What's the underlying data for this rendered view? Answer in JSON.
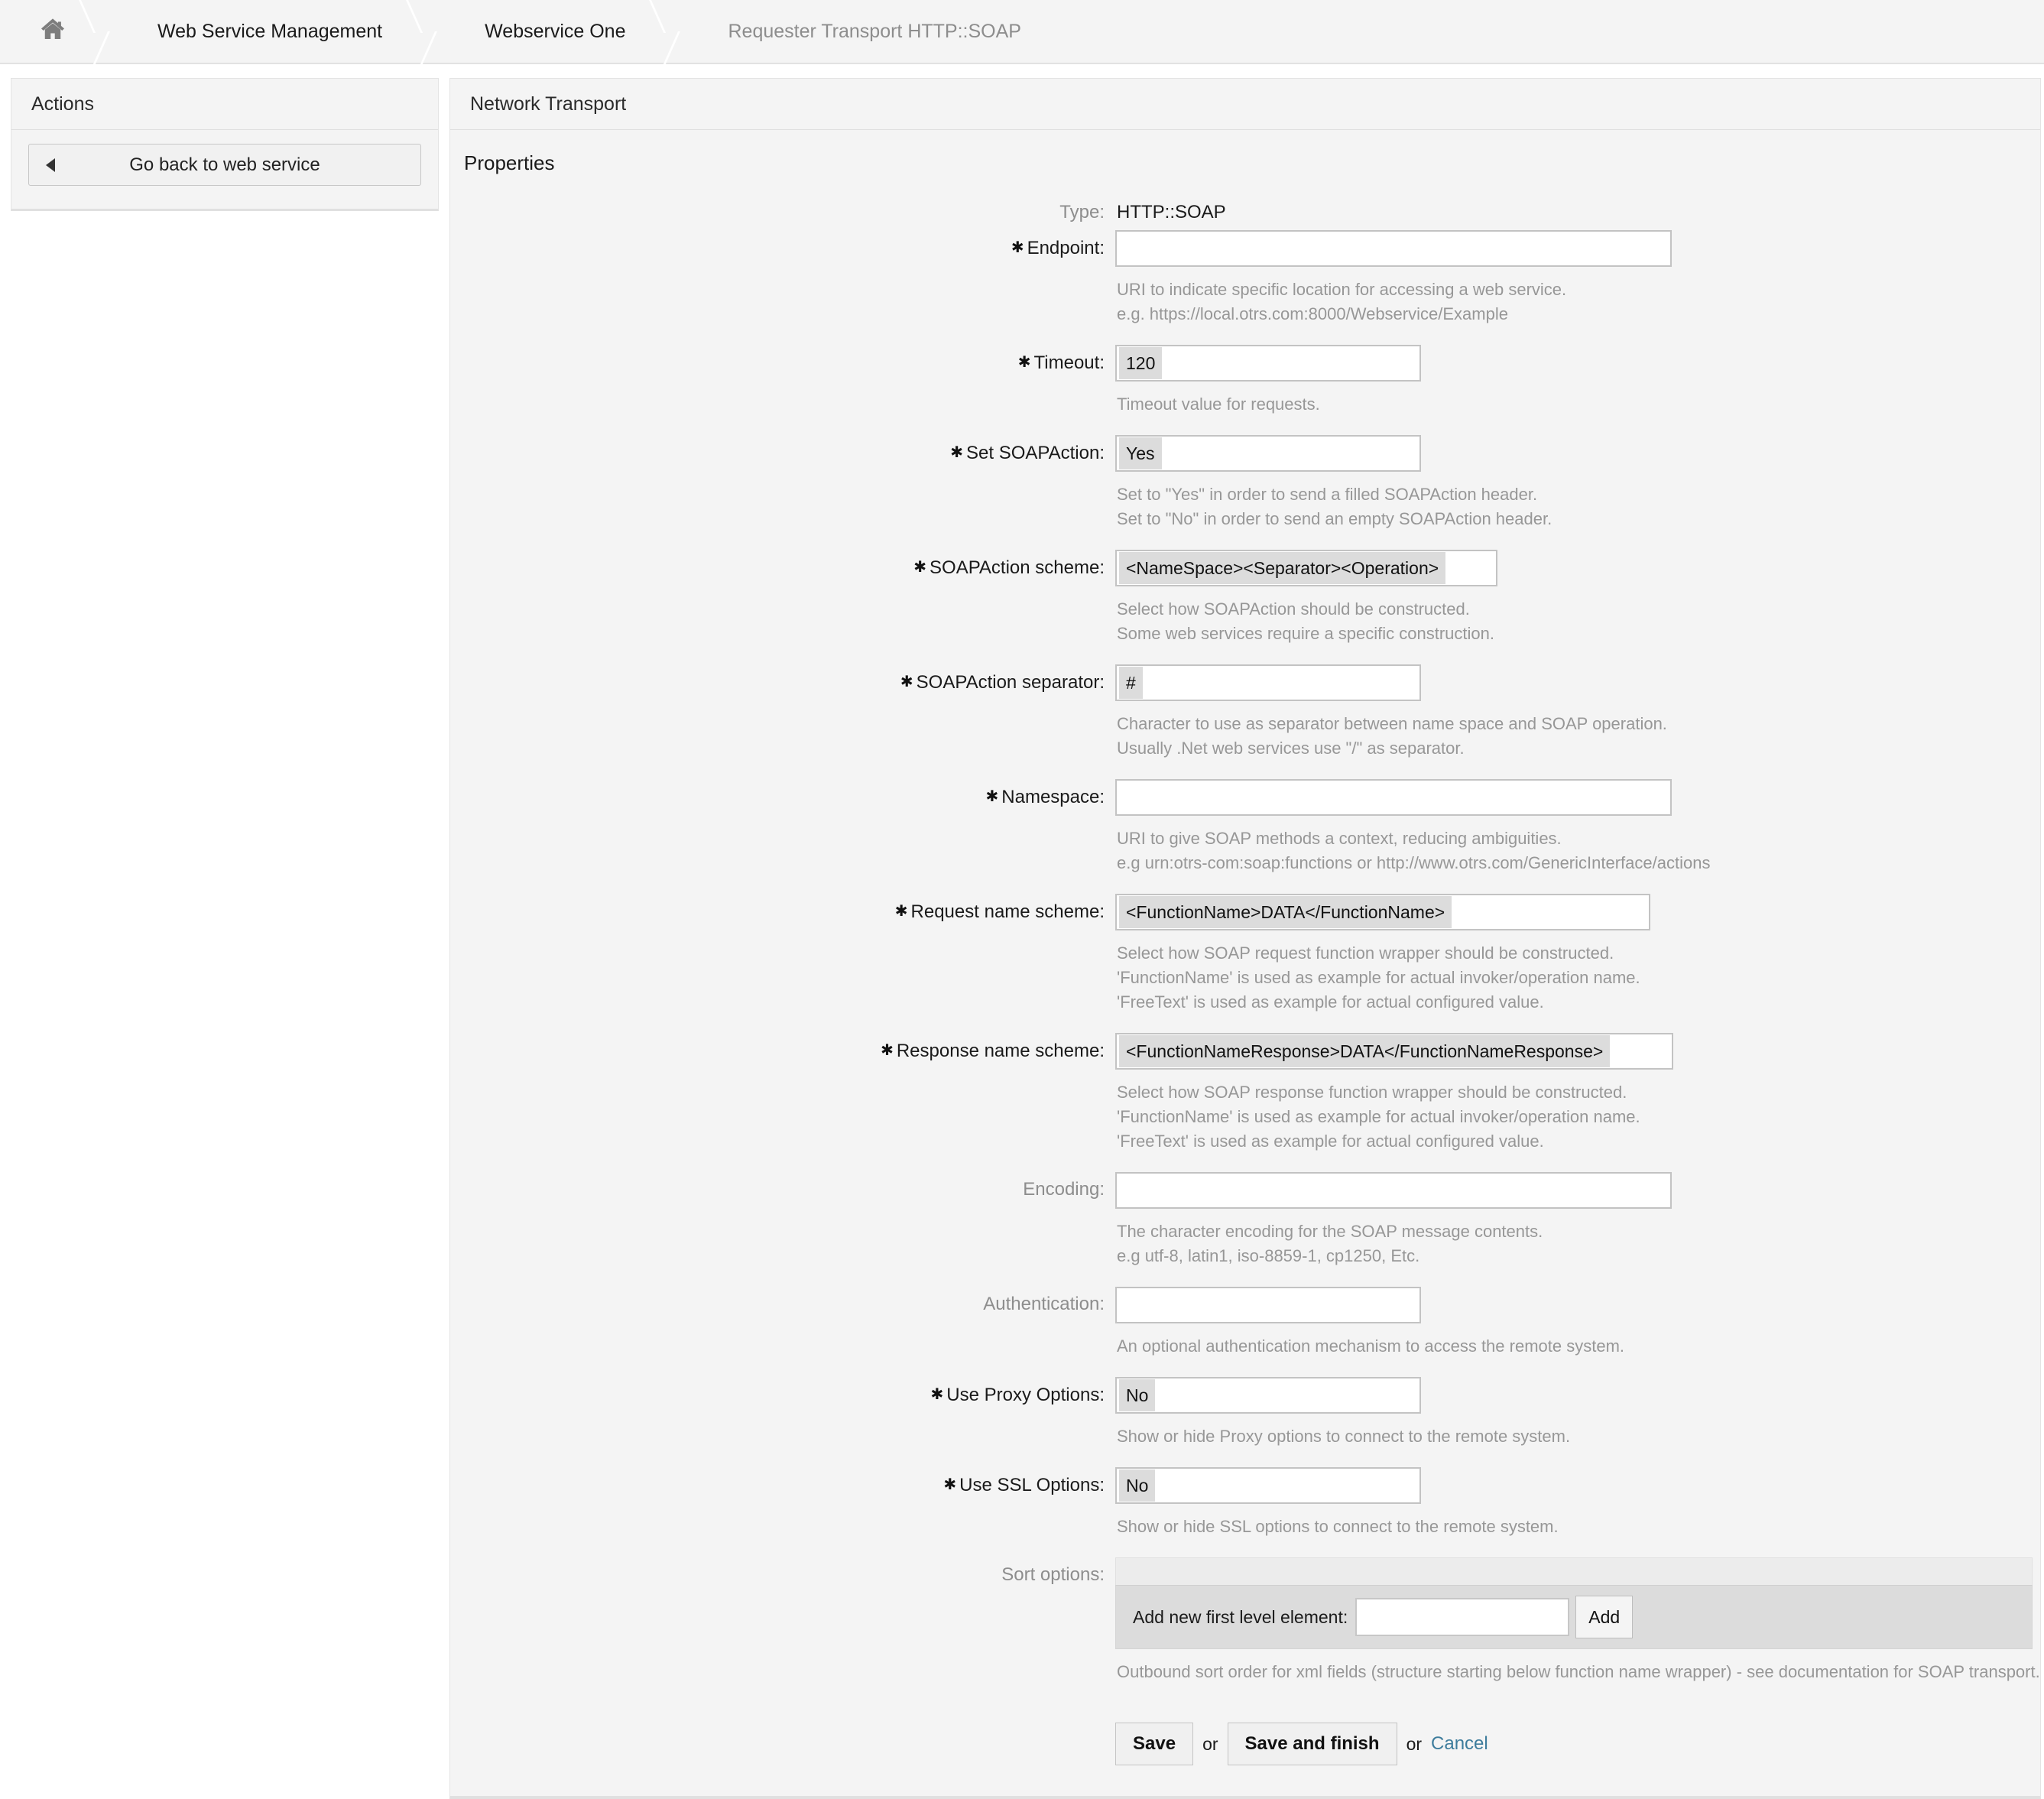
{
  "breadcrumb": {
    "home_icon": "home-icon",
    "items": [
      {
        "label": "Web Service Management",
        "current": false
      },
      {
        "label": "Webservice One",
        "current": false
      },
      {
        "label": "Requester Transport HTTP::SOAP",
        "current": true
      }
    ]
  },
  "sidebar": {
    "title": "Actions",
    "back_button": "Go back to web service"
  },
  "main": {
    "header": "Network Transport",
    "section_title": "Properties"
  },
  "fields": {
    "type": {
      "label": "Type:",
      "value": "HTTP::SOAP"
    },
    "endpoint": {
      "label": "Endpoint:",
      "value": "",
      "hint1": "URI to indicate specific location for accessing a web service.",
      "hint2": "e.g. https://local.otrs.com:8000/Webservice/Example"
    },
    "timeout": {
      "label": "Timeout:",
      "value": "120",
      "hint1": "Timeout value for requests."
    },
    "set_soapaction": {
      "label": "Set SOAPAction:",
      "value": "Yes",
      "hint1": "Set to \"Yes\" in order to send a filled SOAPAction header.",
      "hint2": "Set to \"No\" in order to send an empty SOAPAction header."
    },
    "soapaction_scheme": {
      "label": "SOAPAction scheme:",
      "value": "<NameSpace><Separator><Operation>",
      "hint1": "Select how SOAPAction should be constructed.",
      "hint2": "Some web services require a specific construction."
    },
    "soapaction_separator": {
      "label": "SOAPAction separator:",
      "value": "#",
      "hint1": "Character to use as separator between name space and SOAP operation.",
      "hint2": "Usually .Net web services use \"/\" as separator."
    },
    "namespace": {
      "label": "Namespace:",
      "value": "",
      "hint1": "URI to give SOAP methods a context, reducing ambiguities.",
      "hint2": "e.g urn:otrs-com:soap:functions or http://www.otrs.com/GenericInterface/actions"
    },
    "request_name_scheme": {
      "label": "Request name scheme:",
      "value": "<FunctionName>DATA</FunctionName>",
      "hint1": "Select how SOAP request function wrapper should be constructed.",
      "hint2": "'FunctionName' is used as example for actual invoker/operation name.",
      "hint3": "'FreeText' is used as example for actual configured value."
    },
    "response_name_scheme": {
      "label": "Response name scheme:",
      "value": "<FunctionNameResponse>DATA</FunctionNameResponse>",
      "hint1": "Select how SOAP response function wrapper should be constructed.",
      "hint2": "'FunctionName' is used as example for actual invoker/operation name.",
      "hint3": "'FreeText' is used as example for actual configured value."
    },
    "encoding": {
      "label": "Encoding:",
      "value": "",
      "hint1": "The character encoding for the SOAP message contents.",
      "hint2": "e.g utf-8, latin1, iso-8859-1, cp1250, Etc."
    },
    "authentication": {
      "label": "Authentication:",
      "value": "",
      "hint1": "An optional authentication mechanism to access the remote system."
    },
    "use_proxy_options": {
      "label": "Use Proxy Options:",
      "value": "No",
      "hint1": "Show or hide Proxy options to connect to the remote system."
    },
    "use_ssl_options": {
      "label": "Use SSL Options:",
      "value": "No",
      "hint1": "Show or hide SSL options to connect to the remote system."
    },
    "sort_options": {
      "label": "Sort options:",
      "add_label": "Add new first level element:",
      "add_value": "",
      "add_button": "Add",
      "hint1": "Outbound sort order for xml fields (structure starting below function name wrapper) - see documentation for SOAP transport."
    }
  },
  "footer": {
    "save": "Save",
    "or1": "or",
    "save_and_finish": "Save and finish",
    "or2": "or",
    "cancel": "Cancel"
  }
}
